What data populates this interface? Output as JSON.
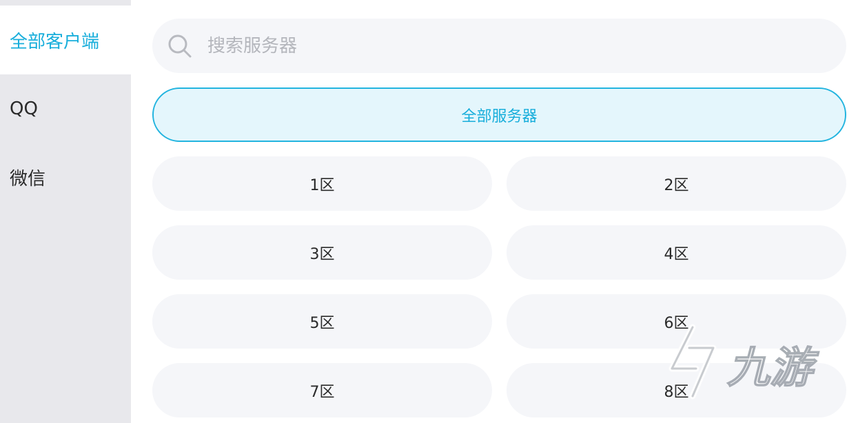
{
  "sidebar": {
    "items": [
      {
        "label": "全部客户端",
        "active": true
      },
      {
        "label": "QQ",
        "active": false
      },
      {
        "label": "微信",
        "active": false
      }
    ]
  },
  "search": {
    "placeholder": "搜索服务器",
    "icon": "search-icon"
  },
  "all_servers_label": "全部服务器",
  "servers": [
    "1区",
    "2区",
    "3区",
    "4区",
    "5区",
    "6区",
    "7区",
    "8区"
  ],
  "watermark": {
    "text": "九游"
  },
  "colors": {
    "accent": "#18aedb",
    "sidebar_bg": "#e8e8ec",
    "button_bg": "#f5f6f9",
    "selected_bg": "#e4f6fc"
  }
}
